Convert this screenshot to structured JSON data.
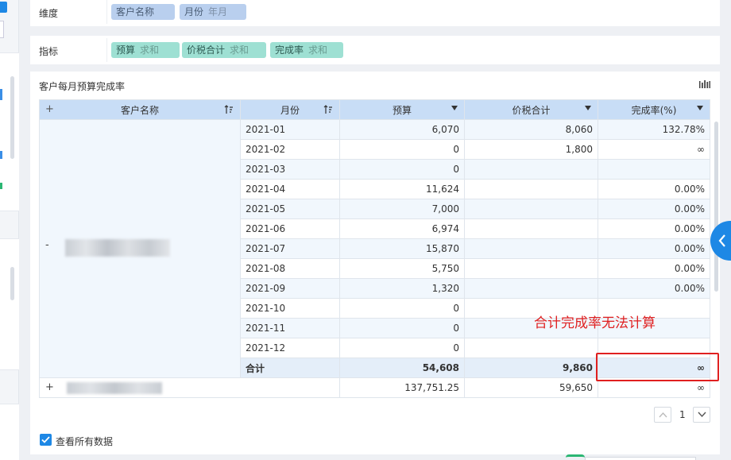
{
  "dimensions": {
    "label": "维度",
    "pills": [
      {
        "name": "客户名称",
        "sub": ""
      },
      {
        "name": "月份",
        "sub": "年月"
      }
    ]
  },
  "metrics": {
    "label": "指标",
    "pills": [
      {
        "name": "预算",
        "sub": "求和"
      },
      {
        "name": "价税合计",
        "sub": "求和"
      },
      {
        "name": "完成率",
        "sub": "求和"
      }
    ]
  },
  "widget": {
    "title": "客户每月预算完成率",
    "icon": "bar-chart-switch-icon"
  },
  "table": {
    "expand_all": "+",
    "headers": [
      "客户名称",
      "月份",
      "预算",
      "价税合计",
      "完成率(%)"
    ],
    "group1": {
      "expand_symbol": "-",
      "rows": [
        {
          "month": "2021-01",
          "budget": "6,070",
          "tax_total": "8,060",
          "rate": "132.78%"
        },
        {
          "month": "2021-02",
          "budget": "0",
          "tax_total": "1,800",
          "rate": "∞"
        },
        {
          "month": "2021-03",
          "budget": "0",
          "tax_total": "",
          "rate": ""
        },
        {
          "month": "2021-04",
          "budget": "11,624",
          "tax_total": "",
          "rate": "0.00%"
        },
        {
          "month": "2021-05",
          "budget": "7,000",
          "tax_total": "",
          "rate": "0.00%"
        },
        {
          "month": "2021-06",
          "budget": "6,974",
          "tax_total": "",
          "rate": "0.00%"
        },
        {
          "month": "2021-07",
          "budget": "15,870",
          "tax_total": "",
          "rate": "0.00%"
        },
        {
          "month": "2021-08",
          "budget": "5,750",
          "tax_total": "",
          "rate": "0.00%"
        },
        {
          "month": "2021-09",
          "budget": "1,320",
          "tax_total": "",
          "rate": "0.00%"
        },
        {
          "month": "2021-10",
          "budget": "0",
          "tax_total": "",
          "rate": ""
        },
        {
          "month": "2021-11",
          "budget": "0",
          "tax_total": "",
          "rate": ""
        },
        {
          "month": "2021-12",
          "budget": "0",
          "tax_total": "",
          "rate": ""
        }
      ],
      "total": {
        "label": "合计",
        "budget": "54,608",
        "tax_total": "9,860",
        "rate": "∞"
      }
    },
    "group2": {
      "expand_symbol": "+",
      "budget": "137,751.25",
      "tax_total": "59,650",
      "rate": "∞"
    }
  },
  "annotation": "合计完成率无法计算",
  "pagination": {
    "current": "1"
  },
  "view_all_label": "查看所有数据",
  "colors": {
    "accent": "#1e88e5",
    "header": "#c8ddf6",
    "dimension_pill": "#b9cfee",
    "metric_pill": "#9ee0d3",
    "annotation": "#e02020"
  }
}
